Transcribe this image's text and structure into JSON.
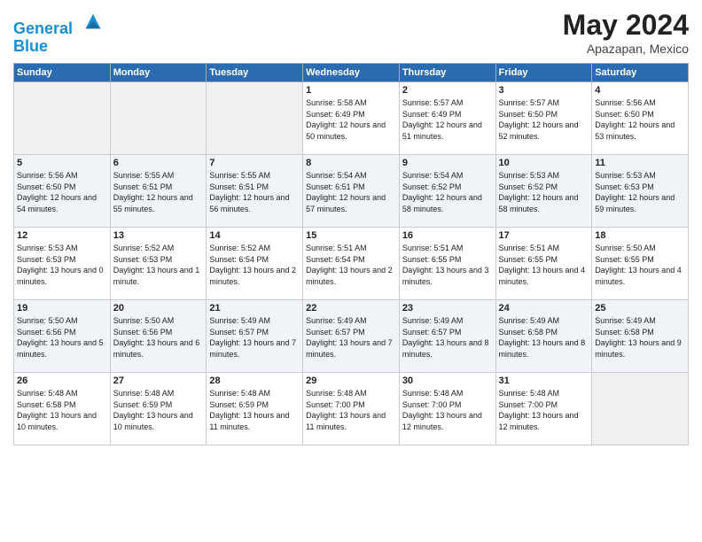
{
  "header": {
    "logo_line1": "General",
    "logo_line2": "Blue",
    "month": "May 2024",
    "location": "Apazapan, Mexico"
  },
  "weekdays": [
    "Sunday",
    "Monday",
    "Tuesday",
    "Wednesday",
    "Thursday",
    "Friday",
    "Saturday"
  ],
  "weeks": [
    [
      {
        "day": "",
        "empty": true
      },
      {
        "day": "",
        "empty": true
      },
      {
        "day": "",
        "empty": true
      },
      {
        "day": "1",
        "sunrise": "5:58 AM",
        "sunset": "6:49 PM",
        "daylight": "12 hours and 50 minutes."
      },
      {
        "day": "2",
        "sunrise": "5:57 AM",
        "sunset": "6:49 PM",
        "daylight": "12 hours and 51 minutes."
      },
      {
        "day": "3",
        "sunrise": "5:57 AM",
        "sunset": "6:50 PM",
        "daylight": "12 hours and 52 minutes."
      },
      {
        "day": "4",
        "sunrise": "5:56 AM",
        "sunset": "6:50 PM",
        "daylight": "12 hours and 53 minutes."
      }
    ],
    [
      {
        "day": "5",
        "sunrise": "5:56 AM",
        "sunset": "6:50 PM",
        "daylight": "12 hours and 54 minutes."
      },
      {
        "day": "6",
        "sunrise": "5:55 AM",
        "sunset": "6:51 PM",
        "daylight": "12 hours and 55 minutes."
      },
      {
        "day": "7",
        "sunrise": "5:55 AM",
        "sunset": "6:51 PM",
        "daylight": "12 hours and 56 minutes."
      },
      {
        "day": "8",
        "sunrise": "5:54 AM",
        "sunset": "6:51 PM",
        "daylight": "12 hours and 57 minutes."
      },
      {
        "day": "9",
        "sunrise": "5:54 AM",
        "sunset": "6:52 PM",
        "daylight": "12 hours and 58 minutes."
      },
      {
        "day": "10",
        "sunrise": "5:53 AM",
        "sunset": "6:52 PM",
        "daylight": "12 hours and 58 minutes."
      },
      {
        "day": "11",
        "sunrise": "5:53 AM",
        "sunset": "6:53 PM",
        "daylight": "12 hours and 59 minutes."
      }
    ],
    [
      {
        "day": "12",
        "sunrise": "5:53 AM",
        "sunset": "6:53 PM",
        "daylight": "13 hours and 0 minutes."
      },
      {
        "day": "13",
        "sunrise": "5:52 AM",
        "sunset": "6:53 PM",
        "daylight": "13 hours and 1 minute."
      },
      {
        "day": "14",
        "sunrise": "5:52 AM",
        "sunset": "6:54 PM",
        "daylight": "13 hours and 2 minutes."
      },
      {
        "day": "15",
        "sunrise": "5:51 AM",
        "sunset": "6:54 PM",
        "daylight": "13 hours and 2 minutes."
      },
      {
        "day": "16",
        "sunrise": "5:51 AM",
        "sunset": "6:55 PM",
        "daylight": "13 hours and 3 minutes."
      },
      {
        "day": "17",
        "sunrise": "5:51 AM",
        "sunset": "6:55 PM",
        "daylight": "13 hours and 4 minutes."
      },
      {
        "day": "18",
        "sunrise": "5:50 AM",
        "sunset": "6:55 PM",
        "daylight": "13 hours and 4 minutes."
      }
    ],
    [
      {
        "day": "19",
        "sunrise": "5:50 AM",
        "sunset": "6:56 PM",
        "daylight": "13 hours and 5 minutes."
      },
      {
        "day": "20",
        "sunrise": "5:50 AM",
        "sunset": "6:56 PM",
        "daylight": "13 hours and 6 minutes."
      },
      {
        "day": "21",
        "sunrise": "5:49 AM",
        "sunset": "6:57 PM",
        "daylight": "13 hours and 7 minutes."
      },
      {
        "day": "22",
        "sunrise": "5:49 AM",
        "sunset": "6:57 PM",
        "daylight": "13 hours and 7 minutes."
      },
      {
        "day": "23",
        "sunrise": "5:49 AM",
        "sunset": "6:57 PM",
        "daylight": "13 hours and 8 minutes."
      },
      {
        "day": "24",
        "sunrise": "5:49 AM",
        "sunset": "6:58 PM",
        "daylight": "13 hours and 8 minutes."
      },
      {
        "day": "25",
        "sunrise": "5:49 AM",
        "sunset": "6:58 PM",
        "daylight": "13 hours and 9 minutes."
      }
    ],
    [
      {
        "day": "26",
        "sunrise": "5:48 AM",
        "sunset": "6:58 PM",
        "daylight": "13 hours and 10 minutes."
      },
      {
        "day": "27",
        "sunrise": "5:48 AM",
        "sunset": "6:59 PM",
        "daylight": "13 hours and 10 minutes."
      },
      {
        "day": "28",
        "sunrise": "5:48 AM",
        "sunset": "6:59 PM",
        "daylight": "13 hours and 11 minutes."
      },
      {
        "day": "29",
        "sunrise": "5:48 AM",
        "sunset": "7:00 PM",
        "daylight": "13 hours and 11 minutes."
      },
      {
        "day": "30",
        "sunrise": "5:48 AM",
        "sunset": "7:00 PM",
        "daylight": "13 hours and 12 minutes."
      },
      {
        "day": "31",
        "sunrise": "5:48 AM",
        "sunset": "7:00 PM",
        "daylight": "13 hours and 12 minutes."
      },
      {
        "day": "",
        "empty": true
      }
    ]
  ]
}
